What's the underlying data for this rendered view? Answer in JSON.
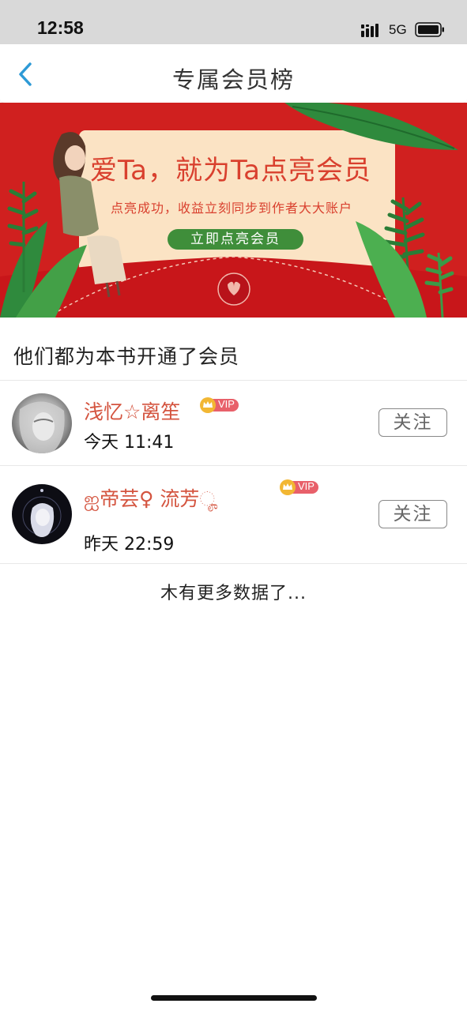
{
  "status_bar": {
    "time": "12:58",
    "network": "5G"
  },
  "nav": {
    "title": "专属会员榜",
    "back_icon": "chevron-left-icon"
  },
  "banner": {
    "title": "爱Ta，就为Ta点亮会员",
    "subtitle": "点亮成功，收益立刻同步到作者大大账户",
    "cta": "立即点亮会员",
    "colors": {
      "background": "#d0201f",
      "card": "#fbe3c4",
      "cta": "#3f8e3a",
      "text": "#d9402e"
    }
  },
  "section": {
    "heading": "他们都为本书开通了会员"
  },
  "members": [
    {
      "name": "浅忆☆离笙",
      "badge": "VIP",
      "time": "今天 11:41",
      "follow_label": "关注"
    },
    {
      "name": "ஐ帝芸♀ 流芳ೄ",
      "badge": "VIP",
      "time": "昨天 22:59",
      "follow_label": "关注"
    }
  ],
  "footer": {
    "no_more": "木有更多数据了..."
  }
}
